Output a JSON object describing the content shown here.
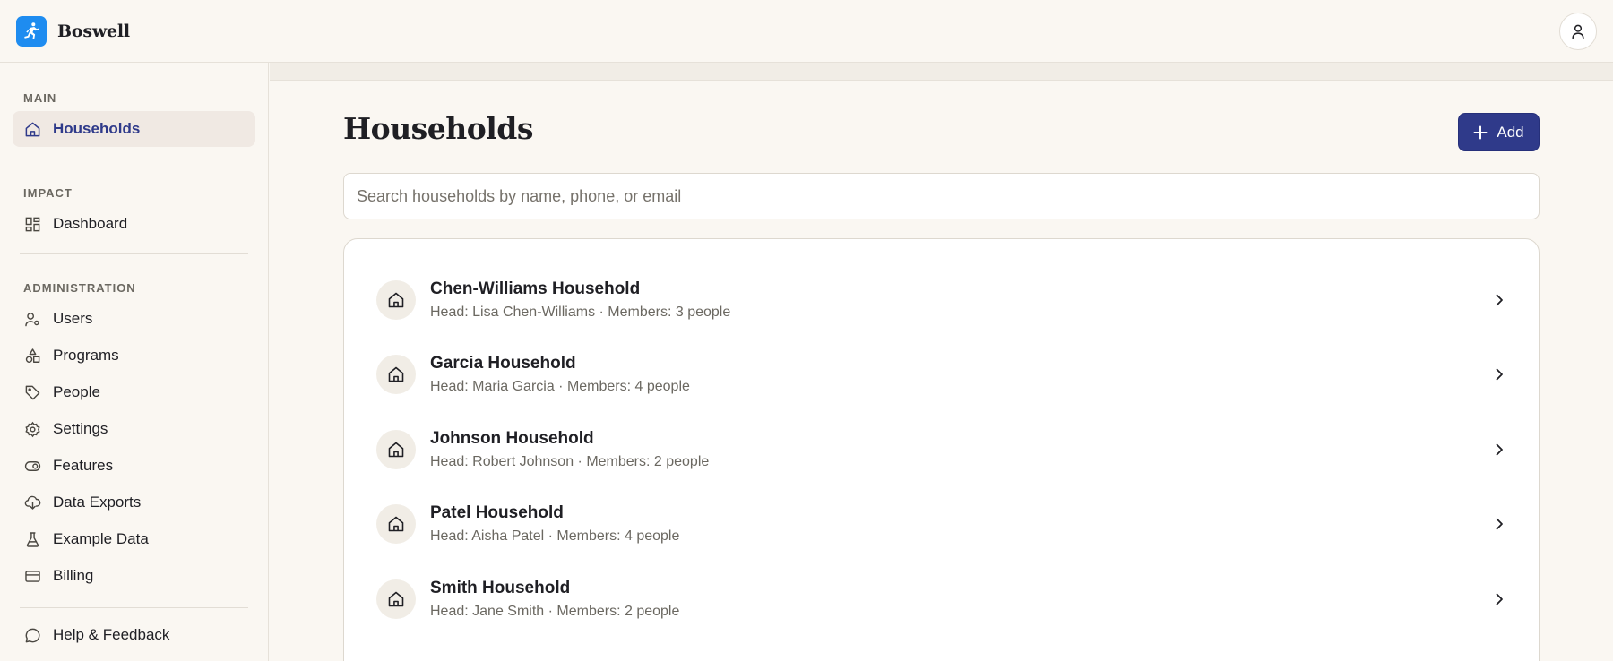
{
  "app": {
    "name": "Boswell"
  },
  "sidebar": {
    "sections": [
      {
        "label": "MAIN",
        "items": [
          {
            "label": "Households",
            "icon": "home-icon",
            "active": true
          }
        ]
      },
      {
        "label": "IMPACT",
        "items": [
          {
            "label": "Dashboard",
            "icon": "dashboard-icon"
          }
        ]
      },
      {
        "label": "ADMINISTRATION",
        "items": [
          {
            "label": "Users",
            "icon": "user-cog-icon"
          },
          {
            "label": "Programs",
            "icon": "shapes-icon"
          },
          {
            "label": "People",
            "icon": "tag-icon"
          },
          {
            "label": "Settings",
            "icon": "gear-icon"
          },
          {
            "label": "Features",
            "icon": "toggle-icon"
          },
          {
            "label": "Data Exports",
            "icon": "cloud-download-icon"
          },
          {
            "label": "Example Data",
            "icon": "flask-icon"
          },
          {
            "label": "Billing",
            "icon": "credit-card-icon"
          }
        ]
      }
    ],
    "footer": {
      "label": "Help & Feedback",
      "icon": "chat-bubble-icon"
    }
  },
  "main": {
    "title": "Households",
    "add_label": "Add",
    "search_placeholder": "Search households by name, phone, or email",
    "households": [
      {
        "name": "Chen-Williams Household",
        "details": "Head: Lisa Chen-Williams · Members: 3 people"
      },
      {
        "name": "Garcia Household",
        "details": "Head: Maria Garcia · Members: 4 people"
      },
      {
        "name": "Johnson Household",
        "details": "Head: Robert Johnson · Members: 2 people"
      },
      {
        "name": "Patel Household",
        "details": "Head: Aisha Patel · Members: 4 people"
      },
      {
        "name": "Smith Household",
        "details": "Head: Jane Smith · Members: 2 people"
      }
    ]
  },
  "colors": {
    "accent": "#2f3a8a",
    "brand": "#1e8cf0",
    "background": "#faf7f2"
  }
}
